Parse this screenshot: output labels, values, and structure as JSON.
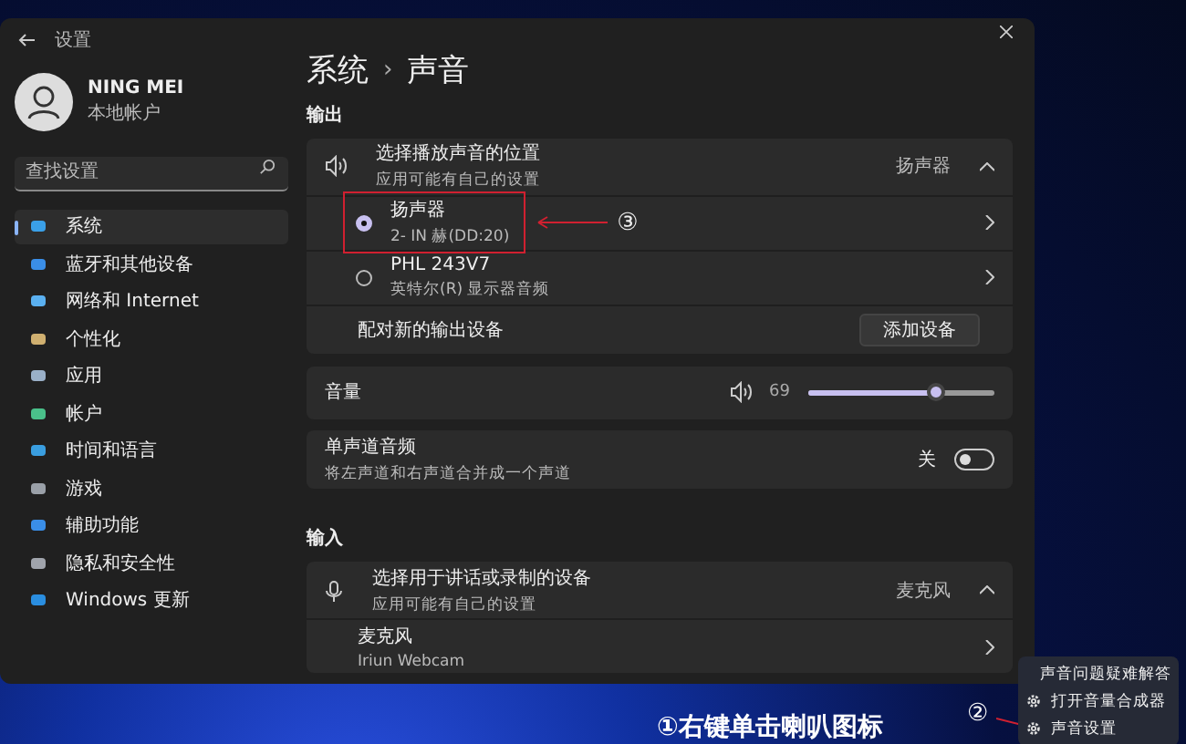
{
  "window": {
    "title": "设置"
  },
  "user": {
    "name": "NING MEI",
    "account": "本地帐户"
  },
  "search": {
    "placeholder": "查找设置"
  },
  "nav": [
    {
      "label": "系统",
      "selected": true
    },
    {
      "label": "蓝牙和其他设备",
      "selected": false
    },
    {
      "label": "网络和 Internet",
      "selected": false
    },
    {
      "label": "个性化",
      "selected": false
    },
    {
      "label": "应用",
      "selected": false
    },
    {
      "label": "帐户",
      "selected": false
    },
    {
      "label": "时间和语言",
      "selected": false
    },
    {
      "label": "游戏",
      "selected": false
    },
    {
      "label": "辅助功能",
      "selected": false
    },
    {
      "label": "隐私和安全性",
      "selected": false
    },
    {
      "label": "Windows 更新",
      "selected": false
    }
  ],
  "breadcrumb": {
    "parent": "系统",
    "separator": "›",
    "current": "声音"
  },
  "output": {
    "heading": "输出",
    "title": "选择播放声音的位置",
    "subtitle": "应用可能有自己的设置",
    "value": "扬声器",
    "expanded": true,
    "devices": [
      {
        "name": "扬声器",
        "detail": "2- IN 赫(DD:20)",
        "selected": true,
        "highlighted": true
      },
      {
        "name": "PHL 243V7",
        "detail": "英特尔(R) 显示器音频",
        "selected": false,
        "highlighted": false
      }
    ],
    "pair_label": "配对新的输出设备",
    "pair_button": "添加设备"
  },
  "volume": {
    "label": "音量",
    "reading": "69",
    "level": 0.69
  },
  "mono": {
    "title": "单声道音频",
    "subtitle": "将左声道和右声道合并成一个声道",
    "state_label": "关",
    "on": false
  },
  "input": {
    "heading": "输入",
    "title": "选择用于讲话或录制的设备",
    "subtitle": "应用可能有自己的设置",
    "value": "麦克风",
    "expanded": true,
    "devices": [
      {
        "name": "麦克风",
        "detail": "Iriun Webcam"
      }
    ]
  },
  "annotation": {
    "label": "③"
  },
  "context_menu": {
    "marker": "②",
    "items": [
      {
        "label": "声音问题疑难解答",
        "kind": "plain"
      },
      {
        "label": "打开音量合成器",
        "kind": "gear"
      },
      {
        "label": "声音设置",
        "kind": "gear"
      }
    ]
  },
  "caption": "①右键单击喇叭图标"
}
